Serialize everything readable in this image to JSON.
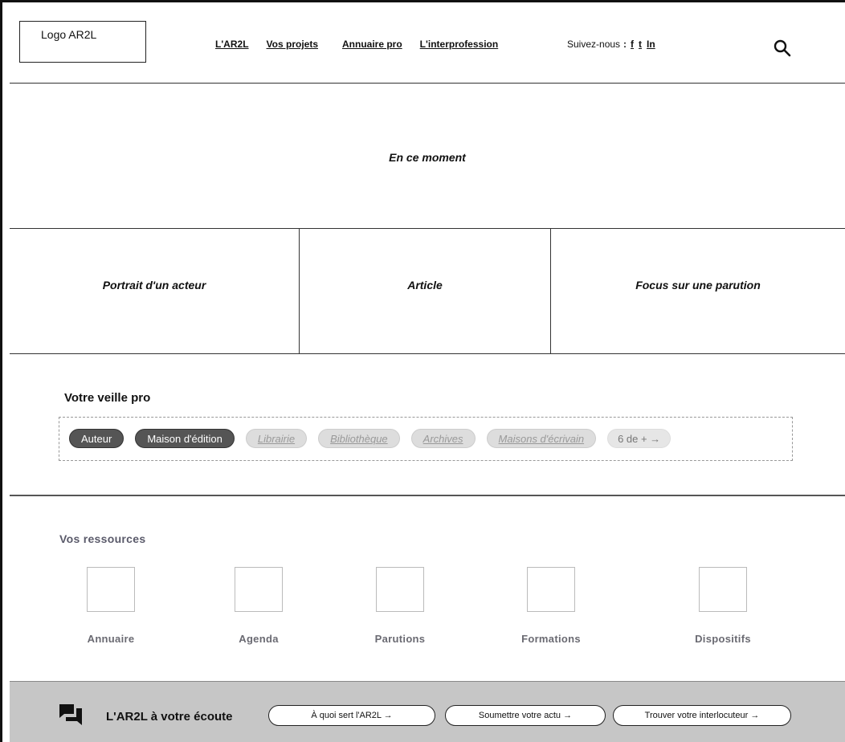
{
  "header": {
    "logo": "Logo AR2L",
    "nav": [
      "L'AR2L",
      "Vos projets",
      "Annuaire pro",
      "L'interprofession"
    ],
    "follow_label": "Suivez-nous",
    "follow_colon": ":",
    "socials": [
      "f",
      "t",
      "In"
    ],
    "search_icon": "search-icon"
  },
  "moment": {
    "title": "En ce moment"
  },
  "cards": [
    "Portrait d'un acteur",
    "Article",
    "Focus sur une parution"
  ],
  "veille": {
    "title": "Votre veille pro",
    "active_tags": [
      "Auteur",
      "Maison d'édition"
    ],
    "inactive_tags": [
      "Librairie",
      "Bibliothèque",
      "Archives",
      "Maisons d'écrivain"
    ],
    "more": "6 de + →"
  },
  "resources": {
    "title": "Vos ressources",
    "items": [
      "Annuaire",
      "Agenda",
      "Parutions",
      "Formations",
      "Dispositifs"
    ]
  },
  "footer": {
    "icon": "chat-icon",
    "title": "L'AR2L à votre écoute",
    "buttons": [
      "À quoi sert l'AR2L →",
      "Soumettre votre actu →",
      "Trouver votre interlocuteur →"
    ]
  },
  "colors": {
    "footer_bg": "#c6c6c6",
    "active_tag": "#555555",
    "inactive_tag": "#dddddd"
  }
}
